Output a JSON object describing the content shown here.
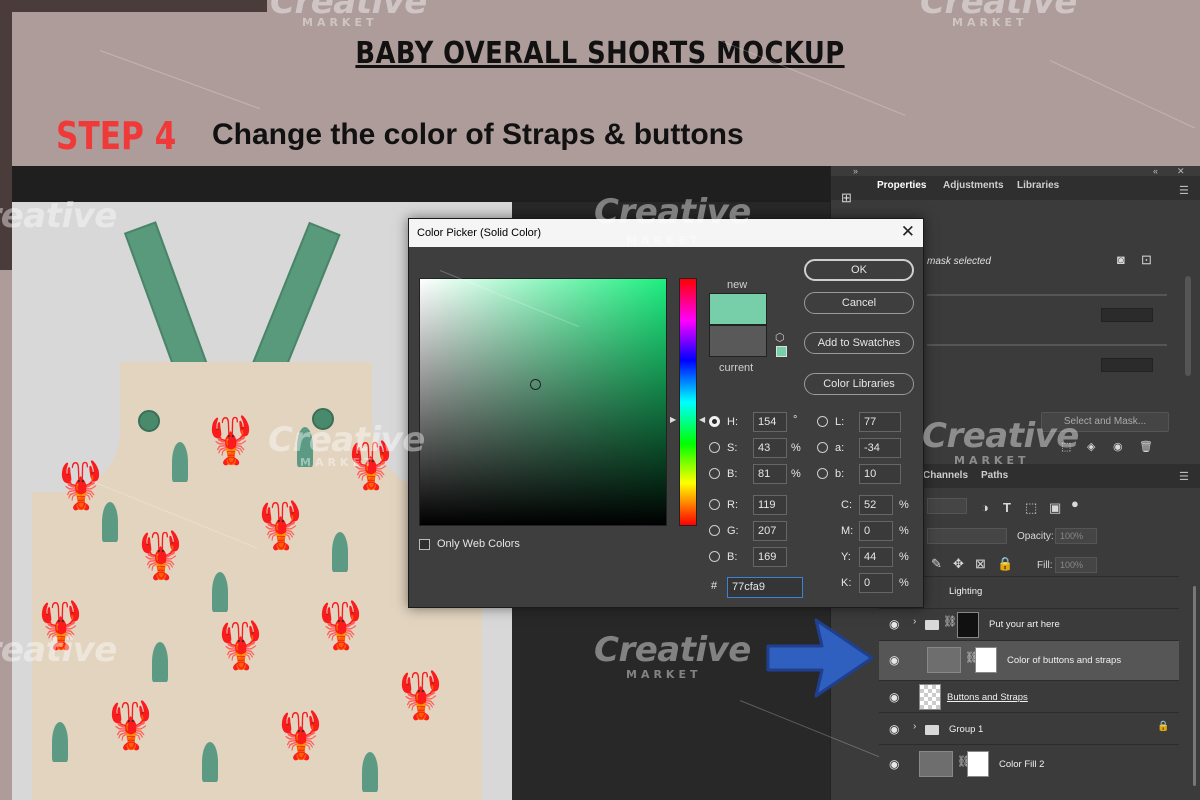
{
  "banner": {
    "title": "BABY OVERALL SHORTS MOCKUP",
    "step": "STEP 4",
    "description": "Change the color of Straps & buttons"
  },
  "watermark": {
    "brand": "Creative",
    "sub": "MARKET"
  },
  "colors": {
    "strap_color": "#77cfa9",
    "accent_blue": "#2f5fbf"
  },
  "properties_panel": {
    "tabs": [
      "Properties",
      "Adjustments",
      "Libraries"
    ],
    "active_tab": "Properties",
    "mask_status": "mask selected",
    "select_and_mask": "Select and Mask..."
  },
  "layers_panel": {
    "tabs": [
      "Channels",
      "Paths"
    ],
    "opacity_label": "Opacity:",
    "opacity_value": "100%",
    "fill_label": "Fill:",
    "fill_value": "100%",
    "layers": [
      {
        "name": "Lighting",
        "type": "group",
        "visible": false
      },
      {
        "name": "Put your art here",
        "type": "group",
        "visible": true
      },
      {
        "name": "Color of buttons and straps",
        "type": "fill",
        "visible": true,
        "selected": true
      },
      {
        "name": "Buttons and Straps",
        "type": "pixel",
        "visible": true
      },
      {
        "name": "Group 1",
        "type": "group",
        "visible": true,
        "locked": true
      },
      {
        "name": "Color Fill 2",
        "type": "fill",
        "visible": true
      }
    ]
  },
  "color_picker": {
    "title": "Color Picker (Solid Color)",
    "new_label": "new",
    "current_label": "current",
    "buttons": {
      "ok": "OK",
      "cancel": "Cancel",
      "add_swatches": "Add to Swatches",
      "color_libraries": "Color Libraries"
    },
    "only_web_colors": "Only Web Colors",
    "hsb": {
      "H": "154",
      "S": "43",
      "B": "81"
    },
    "hsb_units": {
      "H": "°",
      "S": "%",
      "B": "%"
    },
    "rgb": {
      "R": "119",
      "G": "207",
      "B": "169"
    },
    "lab": {
      "L": "77",
      "a": "-34",
      "b": "10"
    },
    "cmyk": {
      "C": "52",
      "M": "0",
      "Y": "44",
      "K": "0"
    },
    "cmyk_unit": "%",
    "hex_label": "#",
    "hex": "77cfa9",
    "labels": {
      "H": "H:",
      "S": "S:",
      "B": "B:",
      "R": "R:",
      "G": "G:",
      "B2": "B:",
      "L": "L:",
      "a": "a:",
      "b": "b:",
      "C": "C:",
      "M": "M:",
      "Y": "Y:",
      "K": "K:"
    }
  }
}
